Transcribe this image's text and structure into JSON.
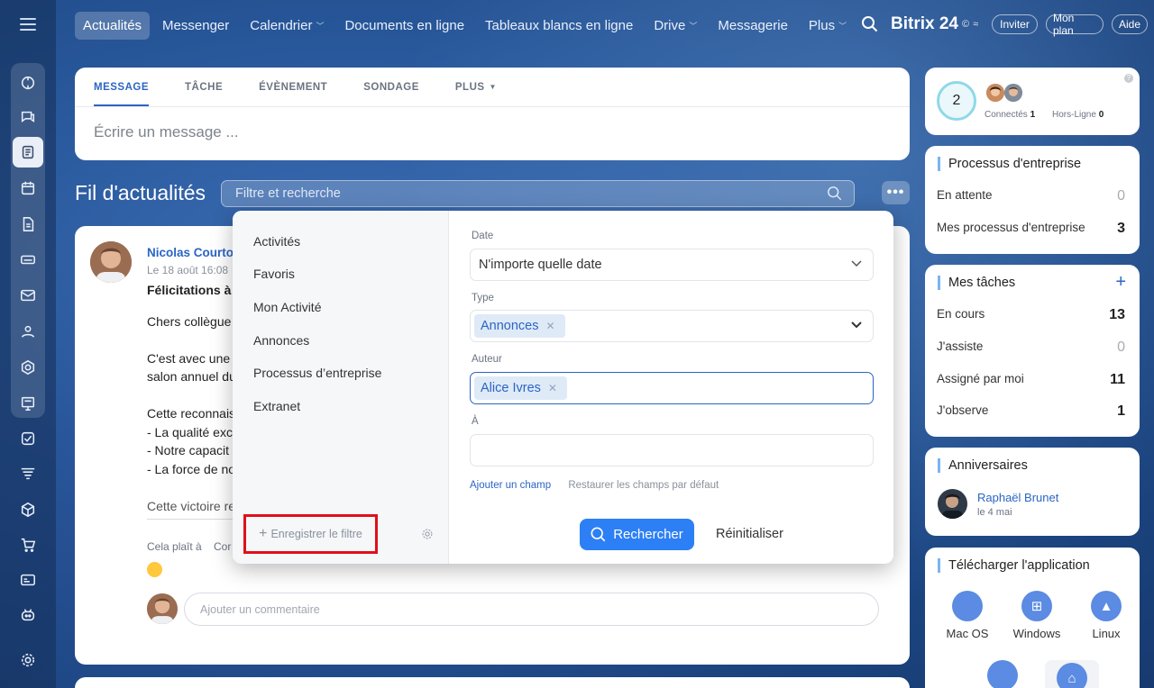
{
  "topnav": {
    "items": [
      {
        "label": "Actualités"
      },
      {
        "label": "Messenger"
      },
      {
        "label": "Calendrier"
      },
      {
        "label": "Documents en ligne"
      },
      {
        "label": "Tableaux blancs en ligne"
      },
      {
        "label": "Drive"
      },
      {
        "label": "Messagerie"
      },
      {
        "label": "Plus"
      }
    ],
    "brand": "Bitrix 24",
    "brand_badge": "©",
    "invite": "Inviter",
    "plan": "Mon plan",
    "help": "Aide"
  },
  "composer": {
    "tabs": [
      "MESSAGE",
      "TÂCHE",
      "ÉVÈNEMENT",
      "SONDAGE",
      "PLUS"
    ],
    "placeholder": "Écrire un message ..."
  },
  "feed": {
    "title": "Fil d'actualités",
    "search_placeholder": "Filtre et recherche",
    "more": "•••"
  },
  "post": {
    "author": "Nicolas Courto",
    "date": "Le 18 août 16:08",
    "title": "Félicitations à",
    "lines": [
      "Chers collègue",
      "C'est avec une",
      "salon annuel du",
      "Cette reconnais",
      "- La qualité exc",
      "- Notre capacit",
      "- La force de no",
      "Cette victoire re"
    ],
    "like": "Cela plaît à",
    "comment_short": "Cor",
    "comment_placeholder": "Ajouter un commentaire"
  },
  "filter": {
    "presets": [
      "Activités",
      "Favoris",
      "Mon Activité",
      "Annonces",
      "Processus d’entreprise",
      "Extranet"
    ],
    "save_filter": "Enregistrer le filtre",
    "date_label": "Date",
    "date_value": "N'importe quelle date",
    "type_label": "Type",
    "type_tag": "Annonces",
    "author_label": "Auteur",
    "author_tag": "Alice Ivres",
    "to_label": "À",
    "add_field": "Ajouter un champ",
    "restore_fields": "Restaurer les champs par défaut",
    "search_btn": "Rechercher",
    "reset_btn": "Réinitialiser"
  },
  "right": {
    "online": {
      "count": "2",
      "connected_label": "Connectés",
      "connected_count": "1",
      "offline_label": "Hors-Ligne",
      "offline_count": "0"
    },
    "processes": {
      "title": "Processus d'entreprise",
      "rows": [
        {
          "label": "En attente",
          "value": "0"
        },
        {
          "label": "Mes processus d'entreprise",
          "value": "3"
        }
      ]
    },
    "tasks": {
      "title": "Mes tâches",
      "add": "+",
      "rows": [
        {
          "label": "En cours",
          "value": "13"
        },
        {
          "label": "J'assiste",
          "value": "0"
        },
        {
          "label": "Assigné par moi",
          "value": "11"
        },
        {
          "label": "J'observe",
          "value": "1"
        }
      ]
    },
    "birthdays": {
      "title": "Anniversaires",
      "name": "Raphaël Brunet",
      "date": "le 4 mai"
    },
    "apps": {
      "title": "Télécharger l'application",
      "items": [
        "Mac OS",
        "Windows",
        "Linux"
      ]
    }
  },
  "colors": {
    "accent": "#2b65c4",
    "button": "#2d7ff5",
    "highlight": "#e0101a"
  }
}
